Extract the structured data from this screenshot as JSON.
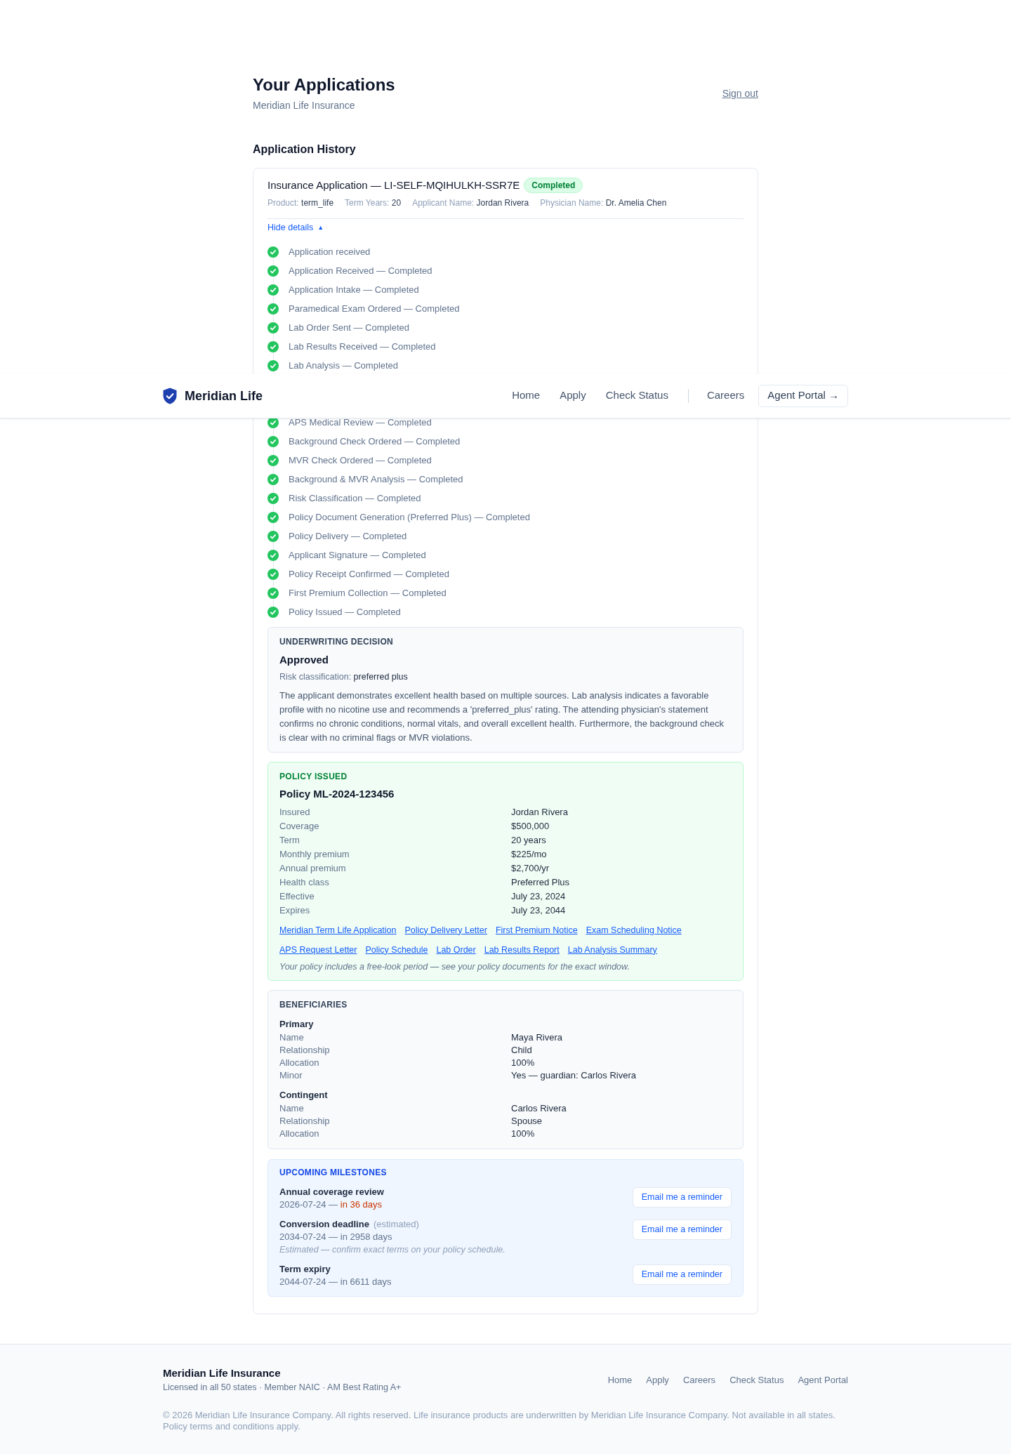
{
  "page_header": {
    "title": "Your Applications",
    "subtitle": "Meridian Life Insurance",
    "sign_out": "Sign out"
  },
  "section_title": "Application History",
  "application": {
    "title": "Insurance Application — LI-SELF-MQIHULKH-SSR7E",
    "status_badge": "Completed",
    "meta": [
      {
        "label": "Product:",
        "value": "term_life"
      },
      {
        "label": "Term Years:",
        "value": "20"
      },
      {
        "label": "Applicant Name:",
        "value": "Jordan Rivera"
      },
      {
        "label": "Physician Name:",
        "value": "Dr. Amelia Chen"
      }
    ],
    "details_toggle": {
      "label": "Hide details",
      "caret": "▲",
      "expanded": true
    },
    "steps_above_nav": [
      {
        "label": "Application received",
        "done": true
      },
      {
        "label": "Application Received — Completed",
        "done": true
      },
      {
        "label": "Application Intake — Completed",
        "done": true
      },
      {
        "label": "Paramedical Exam Ordered — Completed",
        "done": true
      },
      {
        "label": "Lab Order Sent — Completed",
        "done": true
      },
      {
        "label": "Lab Results Received — Completed",
        "done": true
      },
      {
        "label": "Lab Analysis — Completed",
        "done": true
      }
    ],
    "steps_below_nav": [
      {
        "label": "APS Medical Review — Completed",
        "done": true
      },
      {
        "label": "Background Check Ordered — Completed",
        "done": true
      },
      {
        "label": "MVR Check Ordered — Completed",
        "done": true
      },
      {
        "label": "Background & MVR Analysis — Completed",
        "done": true
      },
      {
        "label": "Risk Classification — Completed",
        "done": true
      },
      {
        "label": "Policy Document Generation (Preferred Plus) — Completed",
        "done": true
      },
      {
        "label": "Policy Delivery — Completed",
        "done": true
      },
      {
        "label": "Applicant Signature — Completed",
        "done": true
      },
      {
        "label": "Policy Receipt Confirmed — Completed",
        "done": true
      },
      {
        "label": "First Premium Collection — Completed",
        "done": true
      },
      {
        "label": "Policy Issued — Completed",
        "done": true
      }
    ],
    "underwriting": {
      "heading": "UNDERWRITING DECISION",
      "decision": "Approved",
      "risk_label": "Risk classification:",
      "risk_value": "preferred plus",
      "summary": "The applicant demonstrates excellent health based on multiple sources. Lab analysis indicates a favorable profile with no nicotine use and recommends a 'preferred_plus' rating. The attending physician's statement confirms no chronic conditions, normal vitals, and overall excellent health. Furthermore, the background check is clear with no criminal flags or MVR violations."
    },
    "policy": {
      "heading": "POLICY ISSUED",
      "title": "Policy ML-2024-123456",
      "rows": [
        {
          "label": "Insured",
          "value": "Jordan Rivera"
        },
        {
          "label": "Coverage",
          "value": "$500,000"
        },
        {
          "label": "Term",
          "value": "20 years"
        },
        {
          "label": "Monthly premium",
          "value": "$225/mo"
        },
        {
          "label": "Annual premium",
          "value": "$2,700/yr"
        },
        {
          "label": "Health class",
          "value": "Preferred Plus"
        },
        {
          "label": "Effective",
          "value": "July 23, 2024"
        },
        {
          "label": "Expires",
          "value": "July 23, 2044"
        }
      ],
      "documents": [
        "Meridian Term Life Application",
        "Policy Delivery Letter",
        "First Premium Notice",
        "Exam Scheduling Notice",
        "APS Request Letter",
        "Policy Schedule",
        "Lab Order",
        "Lab Results Report",
        "Lab Analysis Summary"
      ],
      "note": "Your policy includes a free-look period — see your policy documents for the exact window."
    },
    "beneficiaries": {
      "heading": "BENEFICIARIES",
      "groups": [
        {
          "title": "Primary",
          "rows": [
            {
              "label": "Name",
              "value": "Maya Rivera"
            },
            {
              "label": "Relationship",
              "value": "Child"
            },
            {
              "label": "Allocation",
              "value": "100%"
            },
            {
              "label": "Minor",
              "value": "Yes — guardian: Carlos Rivera"
            }
          ]
        },
        {
          "title": "Contingent",
          "rows": [
            {
              "label": "Name",
              "value": "Carlos Rivera"
            },
            {
              "label": "Relationship",
              "value": "Spouse"
            },
            {
              "label": "Allocation",
              "value": "100%"
            }
          ]
        }
      ]
    },
    "milestones": {
      "heading": "UPCOMING MILESTONES",
      "items": [
        {
          "title": "Annual coverage review",
          "date": "2026-07-24 —",
          "countdown": "in 36 days",
          "urgent": true,
          "button": "Email me a reminder"
        },
        {
          "title": "Conversion deadline",
          "qualifier": "(estimated)",
          "date": "2034-07-24 —",
          "countdown": "in 2958 days",
          "urgent": false,
          "note": "Estimated — confirm exact terms on your policy schedule.",
          "button": "Email me a reminder"
        },
        {
          "title": "Term expiry",
          "date": "2044-07-24 —",
          "countdown": "in 6611 days",
          "urgent": false,
          "button": "Email me a reminder"
        }
      ]
    }
  },
  "nav": {
    "brand": "Meridian Life",
    "links": [
      "Home",
      "Apply",
      "Check Status"
    ],
    "secondary_links": [
      "Careers"
    ],
    "cta": "Agent Portal →"
  },
  "footer": {
    "brand": "Meridian Life Insurance",
    "tagline": "Licensed in all 50 states · Member NAIC · AM Best Rating A+",
    "links": [
      "Home",
      "Apply",
      "Careers",
      "Check Status",
      "Agent Portal"
    ],
    "copyright": "© 2026 Meridian Life Insurance Company. All rights reserved. Life insurance products are underwritten by Meridian Life Insurance Company. Not available in all states. Policy terms and conditions apply."
  }
}
